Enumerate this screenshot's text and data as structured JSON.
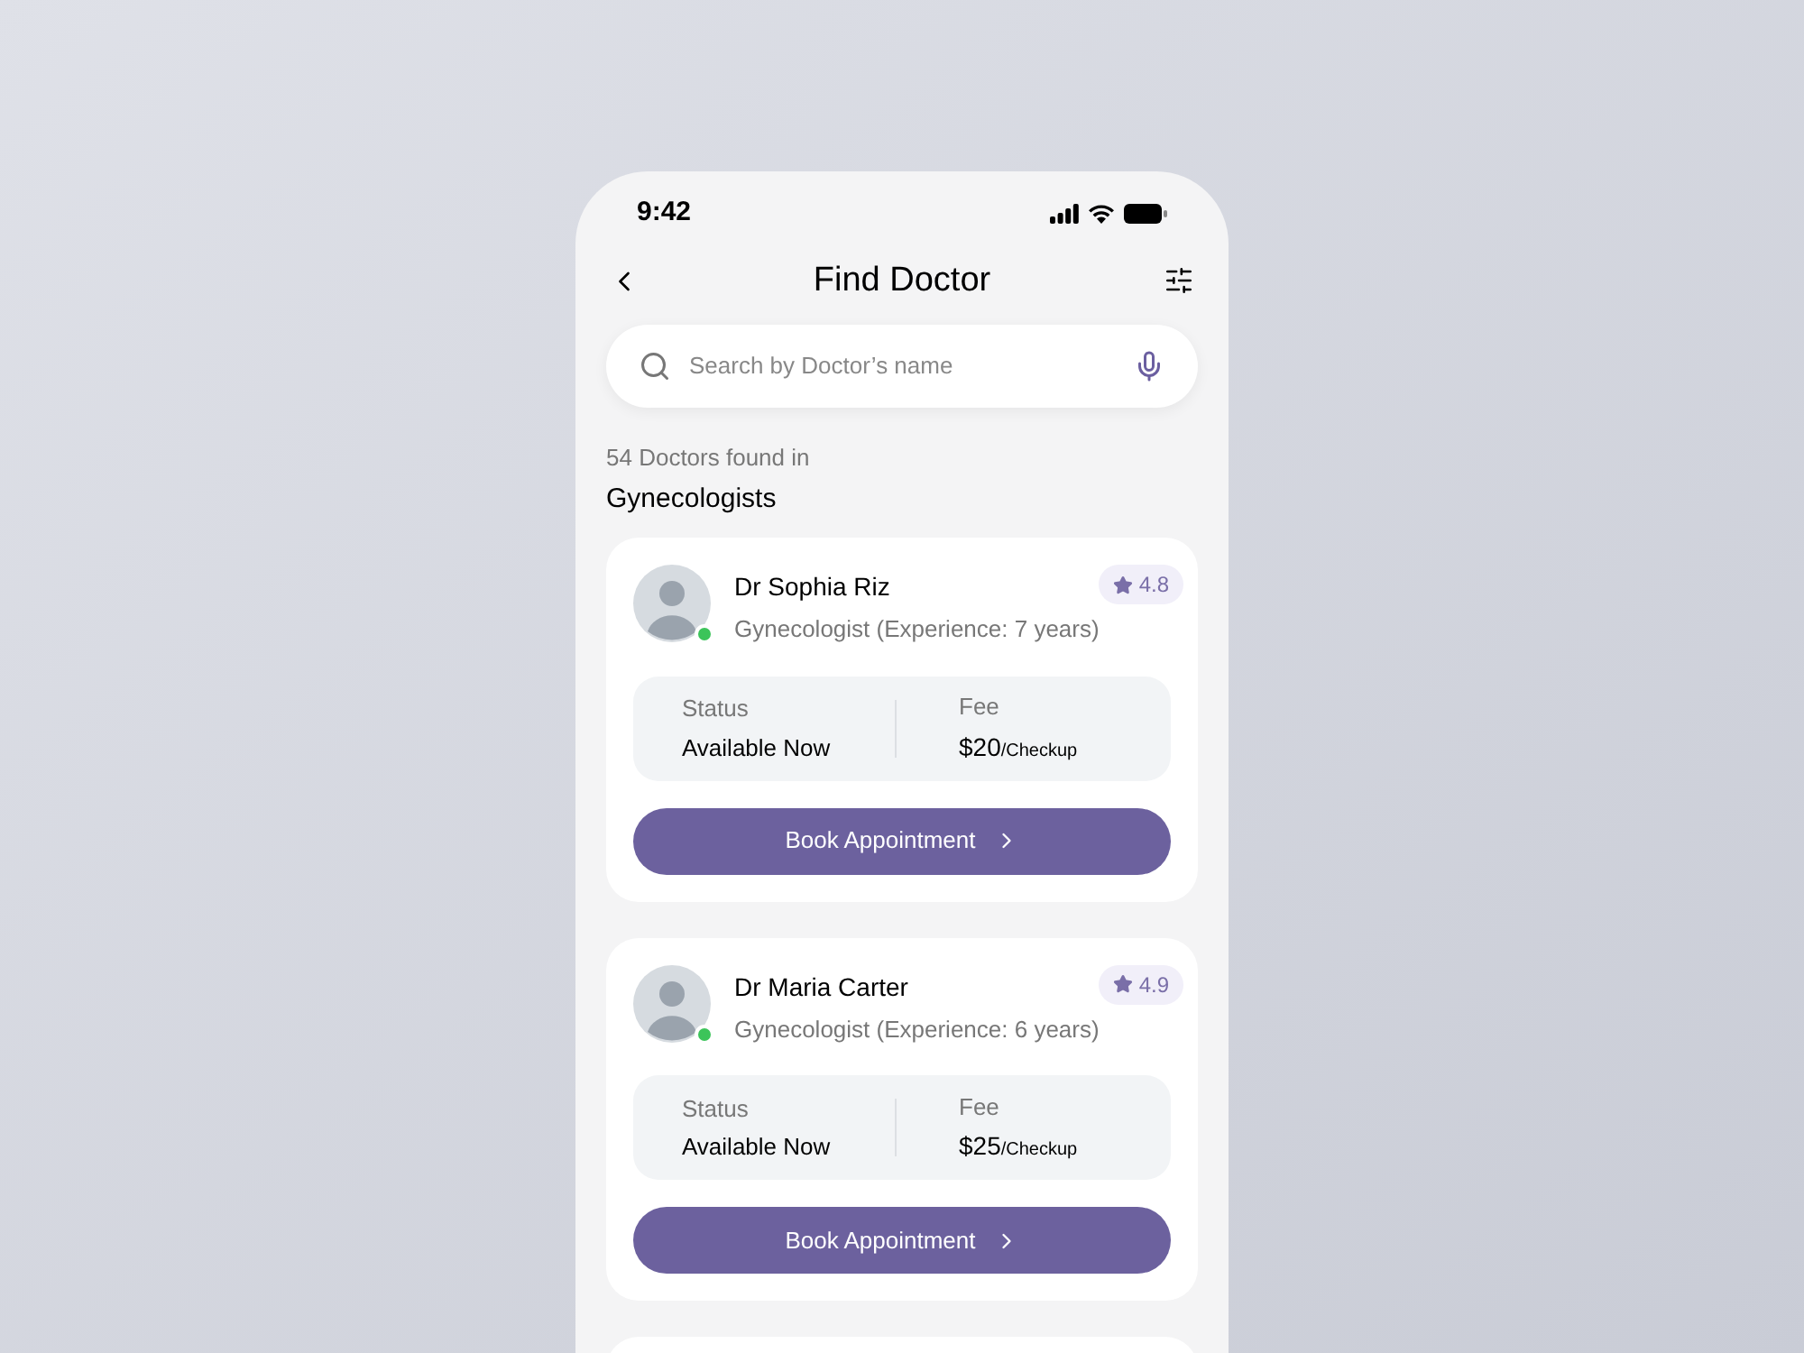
{
  "status_bar": {
    "time": "9:42"
  },
  "header": {
    "title": "Find Doctor"
  },
  "search": {
    "placeholder": "Search by Doctor’s name"
  },
  "results": {
    "count_text": "54 Doctors found in",
    "category": "Gynecologists"
  },
  "doctors": [
    {
      "name": "Dr Sophia Riz",
      "specialty": "Gynecologist (Experience: 7 years)",
      "rating": "4.8",
      "online": true,
      "status_label": "Status",
      "status": "Available Now",
      "fee_label": "Fee",
      "fee": "$20",
      "fee_unit": "/Checkup",
      "button": "Book Appointment"
    },
    {
      "name": "Dr Maria Carter",
      "specialty": "Gynecologist (Experience: 6 years)",
      "rating": "4.9",
      "online": true,
      "status_label": "Status",
      "status": "Available Now",
      "fee_label": "Fee",
      "fee": "$25",
      "fee_unit": "/Checkup",
      "button": "Book Appointment"
    }
  ]
}
